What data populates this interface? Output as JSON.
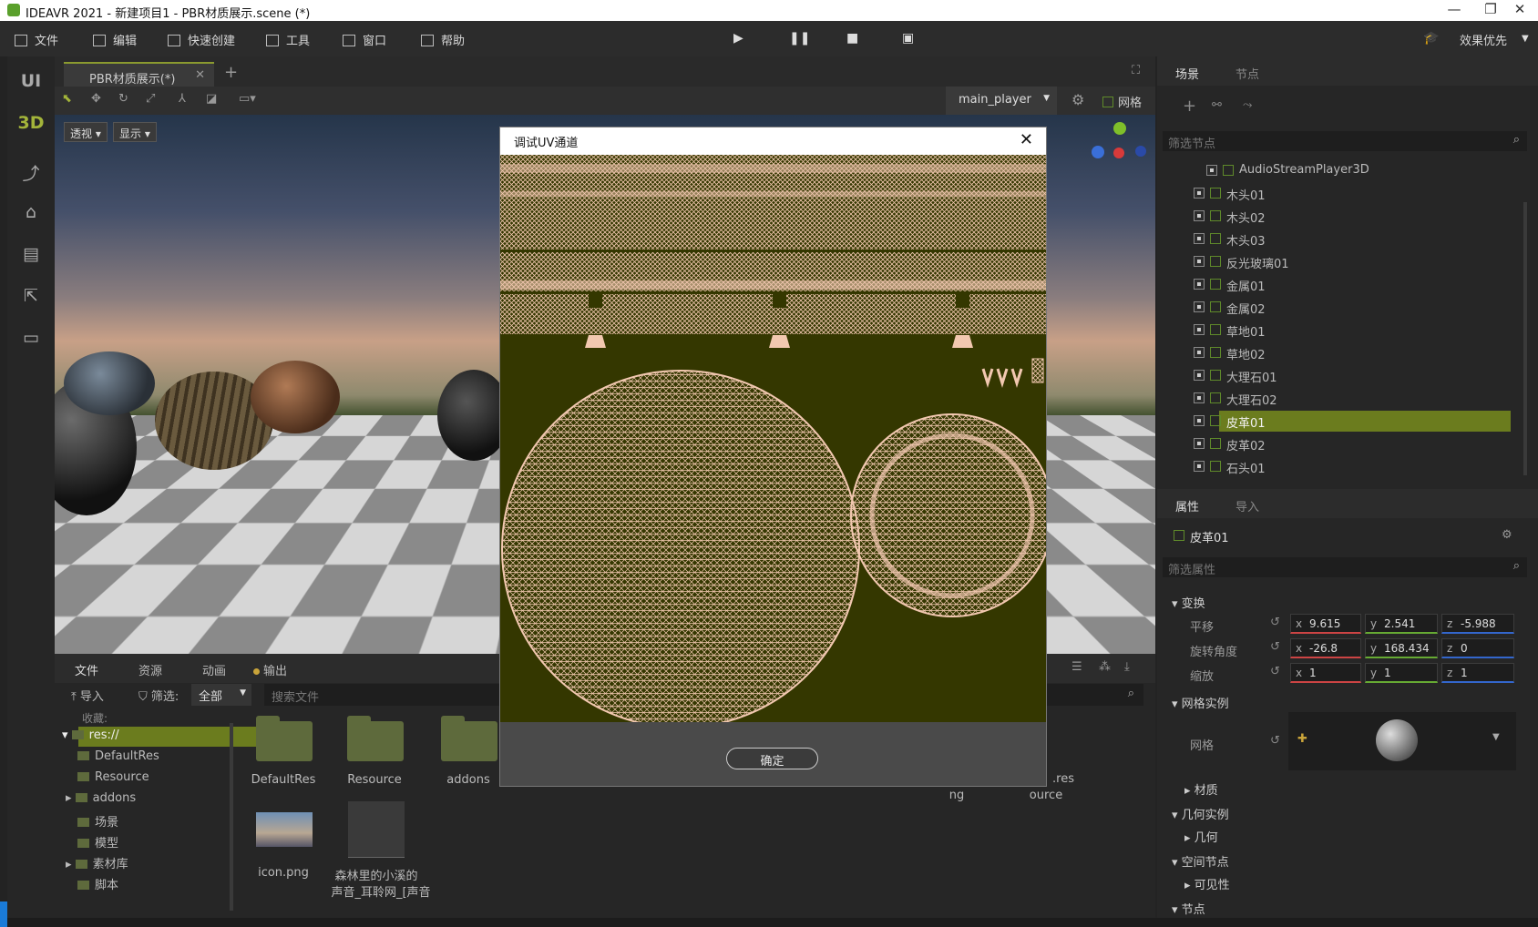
{
  "window": {
    "title": "IDEAVR 2021 - 新建项目1 - PBR材质展示.scene (*)"
  },
  "menu": {
    "items": [
      "文件",
      "编辑",
      "快速创建",
      "工具",
      "窗口",
      "帮助"
    ],
    "right_label": "效果优先"
  },
  "left_toolbar": {
    "ui_label": "UI",
    "3d_label": "3D"
  },
  "viewport": {
    "tab_label": "PBR材质展示(*)",
    "camera_select": "main_player",
    "grid_label": "网格",
    "perspective_btn": "透视",
    "display_btn": "显示"
  },
  "scene_panel": {
    "tabs": [
      "场景",
      "节点"
    ],
    "filter_placeholder": "筛选节点",
    "nodes": [
      "AudioStreamPlayer3D",
      "木头01",
      "木头02",
      "木头03",
      "反光玻璃01",
      "金属01",
      "金属02",
      "草地01",
      "草地02",
      "大理石01",
      "大理石02",
      "皮革01",
      "皮革02",
      "石头01"
    ],
    "selected": "皮革01"
  },
  "inspector": {
    "tabs": [
      "属性",
      "导入"
    ],
    "node_name": "皮革01",
    "filter_placeholder": "筛选属性",
    "transform_section": "变换",
    "translate_label": "平移",
    "rotate_label": "旋转角度",
    "scale_label": "缩放",
    "translate": {
      "x": "9.615",
      "y": "2.541",
      "z": "-5.988"
    },
    "rotate": {
      "x": "-26.8",
      "y": "168.434",
      "z": "0"
    },
    "scale": {
      "x": "1",
      "y": "1",
      "z": "1"
    },
    "mesh_instance_section": "网格实例",
    "mesh_label": "网格",
    "material_label": "材质",
    "geometry_instance_section": "几何实例",
    "geometry_label": "几何",
    "spatial_section": "空间节点",
    "visible_label": "可见性",
    "node_section": "节点"
  },
  "file_panel": {
    "tabs": [
      "文件",
      "资源",
      "动画",
      "输出"
    ],
    "import_label": "导入",
    "filter_label": "筛选:",
    "filter_value": "全部",
    "search_placeholder": "搜索文件",
    "fav_label": "收藏:",
    "tree": [
      "res://",
      "DefaultRes",
      "Resource",
      "addons",
      "场景",
      "模型",
      "素材库",
      "脚本"
    ],
    "grid_items": [
      "DefaultRes",
      "Resource",
      "addons",
      "icon.png",
      "森林里的小溪的",
      "声音_耳聆网_[声音"
    ],
    "partial_labels": [
      "ng",
      "ource",
      ".res"
    ]
  },
  "dialog": {
    "title": "调试UV通道",
    "ok_label": "确定"
  },
  "colors": {
    "accent": "#6b7c1e",
    "uv_bg": "#343700",
    "uv_line": "#f2c8b0"
  }
}
